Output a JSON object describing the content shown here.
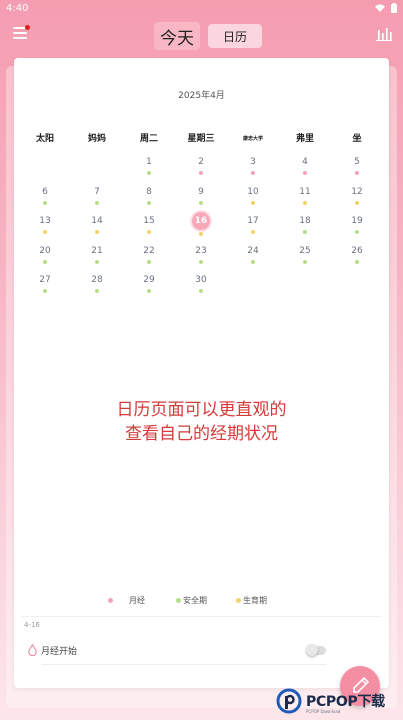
{
  "status": {
    "time": "4:40"
  },
  "header": {
    "tab_today": "今天",
    "tab_calendar": "日历"
  },
  "calendar": {
    "month_title": "2025年4月",
    "weekdays": [
      "太阳",
      "妈妈",
      "周二",
      "星期三",
      "康忠大学",
      "弗里",
      "坐"
    ],
    "leading_blank_days": 2,
    "today": 16,
    "days": [
      {
        "d": "1",
        "dot": "safe"
      },
      {
        "d": "2",
        "dot": "period"
      },
      {
        "d": "3",
        "dot": "period"
      },
      {
        "d": "4",
        "dot": "period"
      },
      {
        "d": "5",
        "dot": "period"
      },
      {
        "d": "6",
        "dot": "safe"
      },
      {
        "d": "7",
        "dot": "safe"
      },
      {
        "d": "8",
        "dot": "safe"
      },
      {
        "d": "9",
        "dot": "safe"
      },
      {
        "d": "10",
        "dot": "fertile"
      },
      {
        "d": "11",
        "dot": "fertile"
      },
      {
        "d": "12",
        "dot": "fertile"
      },
      {
        "d": "13",
        "dot": "fertile"
      },
      {
        "d": "14",
        "dot": "fertile"
      },
      {
        "d": "15",
        "dot": "fertile"
      },
      {
        "d": "16",
        "dot": "fertile"
      },
      {
        "d": "17",
        "dot": "fertile"
      },
      {
        "d": "18",
        "dot": "safe"
      },
      {
        "d": "19",
        "dot": "safe"
      },
      {
        "d": "20",
        "dot": "safe"
      },
      {
        "d": "21",
        "dot": "safe"
      },
      {
        "d": "22",
        "dot": "safe"
      },
      {
        "d": "23",
        "dot": "safe"
      },
      {
        "d": "24",
        "dot": "safe"
      },
      {
        "d": "25",
        "dot": "safe"
      },
      {
        "d": "26",
        "dot": "safe"
      },
      {
        "d": "27",
        "dot": "safe"
      },
      {
        "d": "28",
        "dot": "safe"
      },
      {
        "d": "29",
        "dot": "safe"
      },
      {
        "d": "30",
        "dot": "safe"
      }
    ]
  },
  "promo": {
    "line1": "日历页面可以更直观的",
    "line2": "查看自己的经期状况"
  },
  "legend": {
    "period_label": "月经",
    "safe_label": "安全期",
    "fertile_label": "生育期"
  },
  "detail": {
    "selected_date": "4-16",
    "period_start_label": "月经开始"
  },
  "watermark": {
    "brand": "PCPOP下载",
    "tagline": "PCPOP Download"
  },
  "colors": {
    "period": "#f4a3b6",
    "safe": "#b9dc8a",
    "fertile": "#f2d36b",
    "accent": "#f38ea3",
    "promo": "#d63a3a"
  }
}
